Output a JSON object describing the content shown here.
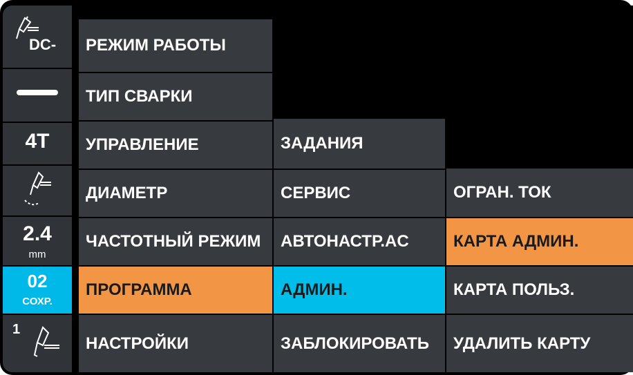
{
  "sidebar": {
    "polarity": "DC-",
    "cycle": "4T",
    "diameter_value": "2.4",
    "diameter_unit": "mm",
    "program_number": "02",
    "program_status": "СОХР.",
    "torch_number": "1"
  },
  "menu": {
    "col1": [
      "РЕЖИМ РАБОТЫ",
      "ТИП СВАРКИ",
      "УПРАВЛЕНИЕ",
      "ДИАМЕТР",
      "ЧАСТОТНЫЙ РЕЖИМ",
      "ПРОГРАММА",
      "НАСТРОЙКИ"
    ],
    "col2": [
      "ЗАДАНИЯ",
      "СЕРВИС",
      "АВТОНАСТР.AC",
      "АДМИН.",
      "ЗАБЛОКИРОВАТЬ"
    ],
    "col3": [
      "ОГРАН. ТОК",
      "КАРТА АДМИН.",
      "КАРТА ПОЛЬЗ.",
      "УДАЛИТЬ КАРТУ"
    ]
  },
  "colors": {
    "accent_orange": "#f29545",
    "accent_blue": "#00bde9",
    "panel": "#373b40"
  }
}
